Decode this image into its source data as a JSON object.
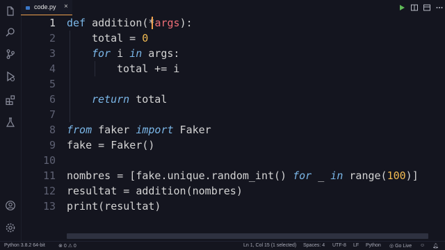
{
  "tab": {
    "filename": "code.py",
    "close_glyph": "×"
  },
  "editor": {
    "active_line": 1,
    "lines": [
      {
        "n": "1"
      },
      {
        "n": "2"
      },
      {
        "n": "3"
      },
      {
        "n": "4"
      },
      {
        "n": "5"
      },
      {
        "n": "6"
      },
      {
        "n": "7"
      },
      {
        "n": "8"
      },
      {
        "n": "9"
      },
      {
        "n": "10"
      },
      {
        "n": "11"
      },
      {
        "n": "12"
      },
      {
        "n": "13"
      }
    ],
    "code": {
      "l1": {
        "def": "def",
        "name": " addition(",
        "star": "*",
        "args": "args",
        "end": "):"
      },
      "l2": {
        "text": "total = ",
        "num": "0"
      },
      "l3": {
        "for": "for",
        "mid": " i ",
        "in": "in",
        "rest": " args:"
      },
      "l4": {
        "text": "total += i"
      },
      "l6": {
        "ret": "return",
        "rest": " total"
      },
      "l8": {
        "from": "from",
        "mid": " faker ",
        "import": "import",
        "rest": " Faker"
      },
      "l9": {
        "text": "fake = Faker()"
      },
      "l11": {
        "a": "nombres = [fake.unique.random_int() ",
        "for": "for",
        "b": " _ ",
        "in": "in",
        "c": " range(",
        "num": "100",
        "d": ")]"
      },
      "l12": {
        "text": "resultat = addition(nombres)"
      },
      "l13": {
        "text": "print(resultat)"
      }
    }
  },
  "statusbar": {
    "python": "Python 3.8.2 64-bit",
    "errors": "0",
    "warnings": "0",
    "position": "Ln 1, Col 15 (1 selected)",
    "spaces": "Spaces: 4",
    "encoding": "UTF-8",
    "eol": "LF",
    "language": "Python",
    "golive": "Go Live"
  },
  "colors": {
    "keyword": "#7bb7e8",
    "number": "#f2bb52",
    "cursor": "#f0a14c",
    "param": "#ef6e76"
  },
  "icons": {
    "activity": [
      "files-icon",
      "search-icon",
      "source-control-icon",
      "run-debug-icon",
      "extensions-icon",
      "flask-icon",
      "account-icon",
      "settings-gear-icon"
    ],
    "toolbar": [
      "run-icon",
      "split-editor-icon",
      "more-icon"
    ]
  }
}
